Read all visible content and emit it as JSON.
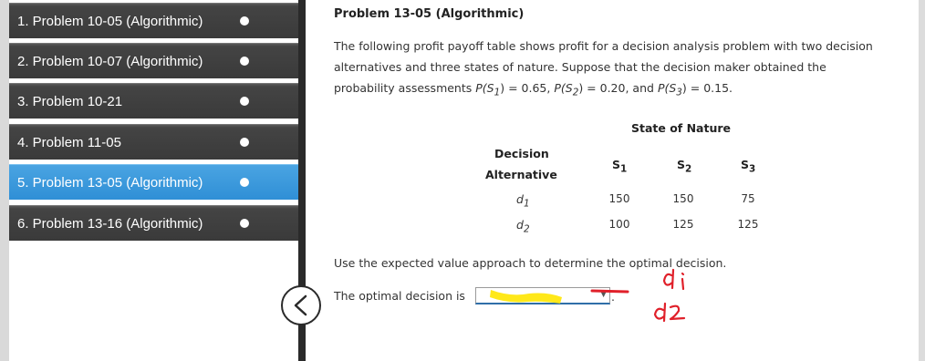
{
  "sidebar": {
    "items": [
      {
        "label": "1. Problem 10-05 (Algorithmic)"
      },
      {
        "label": "2. Problem 10-07 (Algorithmic)"
      },
      {
        "label": "3. Problem 10-21"
      },
      {
        "label": "4. Problem 11-05"
      },
      {
        "label": "5. Problem 13-05 (Algorithmic)"
      },
      {
        "label": "6. Problem 13-16 (Algorithmic)"
      }
    ],
    "active_index": 4,
    "collapse_icon": "chevron-left-icon"
  },
  "problem": {
    "title": "Problem 13-05 (Algorithmic)",
    "para_line1": "The following profit payoff table shows profit for a decision analysis problem with two decision",
    "para_line2": "alternatives and three states of nature. Suppose that the decision maker obtained the",
    "para_line3_prefix": "probability assessments",
    "p1": "P(S",
    "p1_sub": "1",
    "p1_val": ") = 0.65,",
    "p2": "P(S",
    "p2_sub": "2",
    "p2_val": ") = 0.20,",
    "and_text": "and",
    "p3": "P(S",
    "p3_sub": "3",
    "p3_val": ") = 0.15."
  },
  "table": {
    "state_header": "State of Nature",
    "decision_header_line1": "Decision",
    "decision_header_line2": "Alternative",
    "columns": [
      {
        "base": "S",
        "sub": "1"
      },
      {
        "base": "S",
        "sub": "2"
      },
      {
        "base": "S",
        "sub": "3"
      }
    ],
    "rows": [
      {
        "base": "d",
        "sub": "1",
        "values": [
          "150",
          "150",
          "75"
        ]
      },
      {
        "base": "d",
        "sub": "2",
        "values": [
          "100",
          "125",
          "125"
        ]
      }
    ]
  },
  "question": {
    "instruction": "Use the expected value approach to determine the optimal decision.",
    "optimal_label": "The optimal decision is",
    "select_value": "",
    "period": "."
  },
  "colors": {
    "nav_dark": "#3a3a3a",
    "nav_active": "#3b9be0",
    "highlight": "#ffe600",
    "annotation_red": "#e0202a"
  }
}
